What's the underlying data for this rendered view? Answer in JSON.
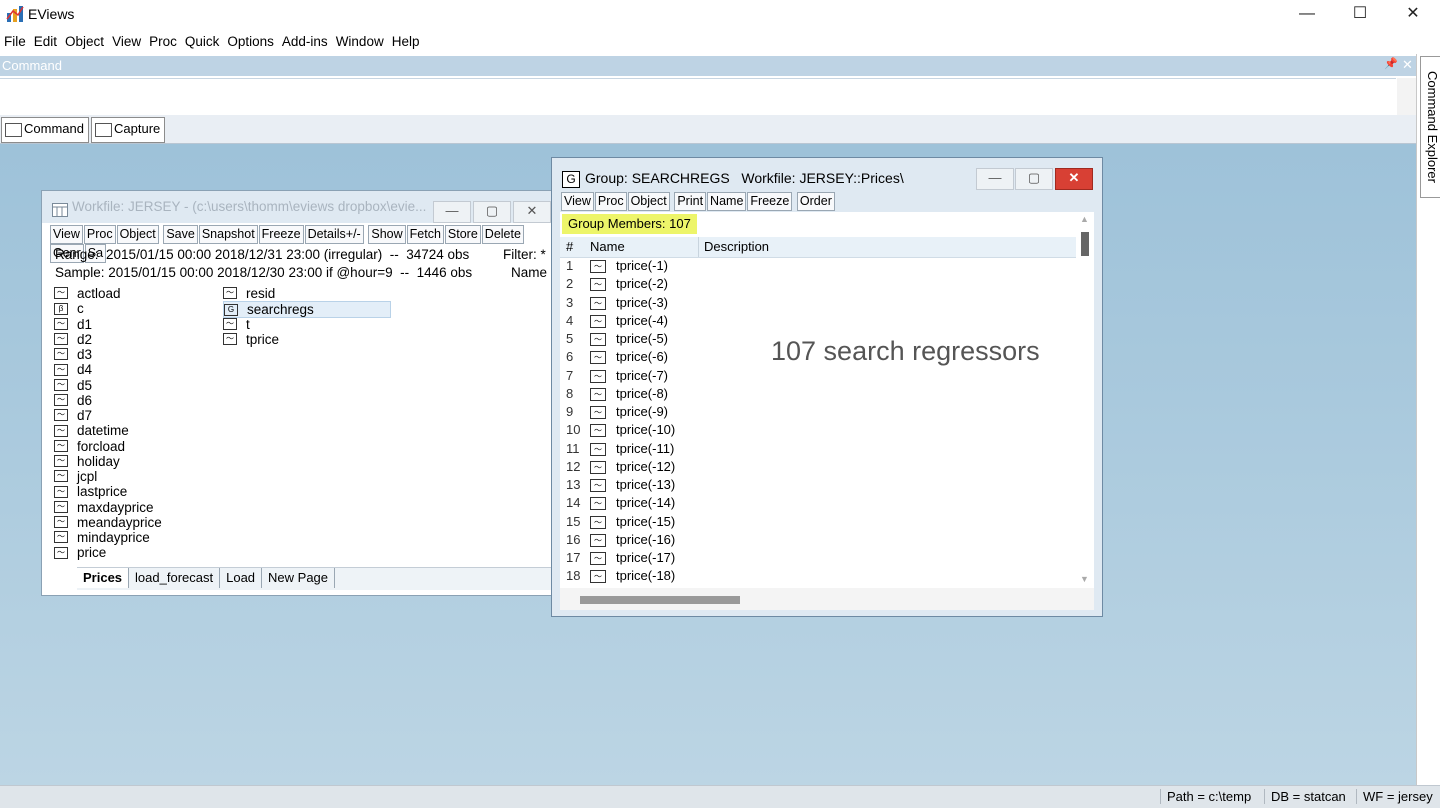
{
  "app": {
    "title": "EViews",
    "minimize": "—",
    "maximize": "☐",
    "close": "✕"
  },
  "menu": [
    "File",
    "Edit",
    "Object",
    "View",
    "Proc",
    "Quick",
    "Options",
    "Add-ins",
    "Window",
    "Help"
  ],
  "command": {
    "header": "Command",
    "pin": "📌",
    "close": "✕",
    "tabs": [
      "Command",
      "Capture"
    ],
    "explorer_label": "Command Explorer"
  },
  "workfile": {
    "title": "Workfile: JERSEY - (c:\\users\\thomm\\eviews dropbox\\evie...",
    "toolbar": [
      "View",
      "Proc",
      "Object",
      "Save",
      "Snapshot",
      "Freeze",
      "Details+/-",
      "Show",
      "Fetch",
      "Store",
      "Delete",
      "Genr",
      "Sa"
    ],
    "range": "Range:  2015/01/15 00:00 2018/12/31 23:00 (irregular)  --  34724 obs",
    "sample": "Sample: 2015/01/15 00:00 2018/12/30 23:00 if @hour=9  --  1446 obs",
    "filter": "Filter: *",
    "name_header": "Name",
    "col1": [
      {
        "name": "actload",
        "icon": "series"
      },
      {
        "name": "c",
        "icon": "coef"
      },
      {
        "name": "d1",
        "icon": "series"
      },
      {
        "name": "d2",
        "icon": "series"
      },
      {
        "name": "d3",
        "icon": "series"
      },
      {
        "name": "d4",
        "icon": "series"
      },
      {
        "name": "d5",
        "icon": "series"
      },
      {
        "name": "d6",
        "icon": "series"
      },
      {
        "name": "d7",
        "icon": "series"
      },
      {
        "name": "datetime",
        "icon": "series"
      },
      {
        "name": "forcload",
        "icon": "series"
      },
      {
        "name": "holiday",
        "icon": "series"
      },
      {
        "name": "jcpl",
        "icon": "series"
      },
      {
        "name": "lastprice",
        "icon": "series"
      },
      {
        "name": "maxdayprice",
        "icon": "series"
      },
      {
        "name": "meandayprice",
        "icon": "series"
      },
      {
        "name": "mindayprice",
        "icon": "series"
      },
      {
        "name": "price",
        "icon": "series"
      }
    ],
    "col2": [
      {
        "name": "resid",
        "icon": "series"
      },
      {
        "name": "searchregs",
        "icon": "group"
      },
      {
        "name": "t",
        "icon": "series"
      },
      {
        "name": "tprice",
        "icon": "series"
      }
    ],
    "tabs": [
      "Prices",
      "load_forecast",
      "Load",
      "New Page"
    ]
  },
  "group": {
    "title": "Group: SEARCHREGS   Workfile: JERSEY::Prices\\",
    "toolbar": [
      "View",
      "Proc",
      "Object",
      "Print",
      "Name",
      "Freeze",
      "Order"
    ],
    "members_label": "Group Members: 107",
    "col_num": "#",
    "col_name": "Name",
    "col_desc": "Description",
    "annotation": "107 search regressors",
    "rows": [
      "tprice(-1)",
      "tprice(-2)",
      "tprice(-3)",
      "tprice(-4)",
      "tprice(-5)",
      "tprice(-6)",
      "tprice(-7)",
      "tprice(-8)",
      "tprice(-9)",
      "tprice(-10)",
      "tprice(-11)",
      "tprice(-12)",
      "tprice(-13)",
      "tprice(-14)",
      "tprice(-15)",
      "tprice(-16)",
      "tprice(-17)",
      "tprice(-18)"
    ]
  },
  "status": {
    "path": "Path = c:\\temp",
    "db": "DB = statcan",
    "wf": "WF = jersey"
  }
}
